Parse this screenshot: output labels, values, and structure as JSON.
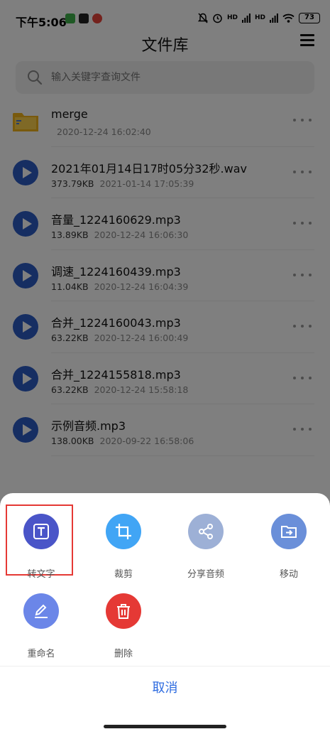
{
  "status_bar": {
    "time": "下午5:06",
    "battery": "73",
    "signal_1": "HD",
    "signal_2": "HD"
  },
  "header": {
    "title": "文件库",
    "menu_icon": "list-icon"
  },
  "search": {
    "placeholder": "输入关键字查询文件",
    "icon": "search-icon"
  },
  "files": [
    {
      "name": "merge",
      "size": "",
      "date": "2020-12-24 16:02:40",
      "type": "folder"
    },
    {
      "name": "2021年01月14日17时05分32秒.wav",
      "size": "373.79KB",
      "date": "2021-01-14 17:05:39",
      "type": "audio"
    },
    {
      "name": "音量_1224160629.mp3",
      "size": "13.89KB",
      "date": "2020-12-24 16:06:30",
      "type": "audio"
    },
    {
      "name": "调速_1224160439.mp3",
      "size": "11.04KB",
      "date": "2020-12-24 16:04:39",
      "type": "audio"
    },
    {
      "name": "合并_1224160043.mp3",
      "size": "63.22KB",
      "date": "2020-12-24 16:00:49",
      "type": "audio"
    },
    {
      "name": "合并_1224155818.mp3",
      "size": "63.22KB",
      "date": "2020-12-24 15:58:18",
      "type": "audio"
    },
    {
      "name": "示例音频.mp3",
      "size": "138.00KB",
      "date": "2020-09-22 16:58:06",
      "type": "audio"
    }
  ],
  "sheet": {
    "actions": [
      {
        "label": "转文字",
        "icon": "text-icon",
        "color": "#4a55c8"
      },
      {
        "label": "裁剪",
        "icon": "crop-icon",
        "color": "#41a5f5"
      },
      {
        "label": "分享音频",
        "icon": "share-icon",
        "color": "#9db0d6"
      },
      {
        "label": "移动",
        "icon": "move-icon",
        "color": "#6a8fd9"
      },
      {
        "label": "重命名",
        "icon": "edit-icon",
        "color": "#6b86e8"
      },
      {
        "label": "删除",
        "icon": "trash-icon",
        "color": "#e53935"
      }
    ],
    "cancel": "取消"
  },
  "colors": {
    "accent": "#2d6be0",
    "audio_icon": "#2c5cc5",
    "folder_icon": "#f3b41a",
    "highlight": "#e53935"
  }
}
